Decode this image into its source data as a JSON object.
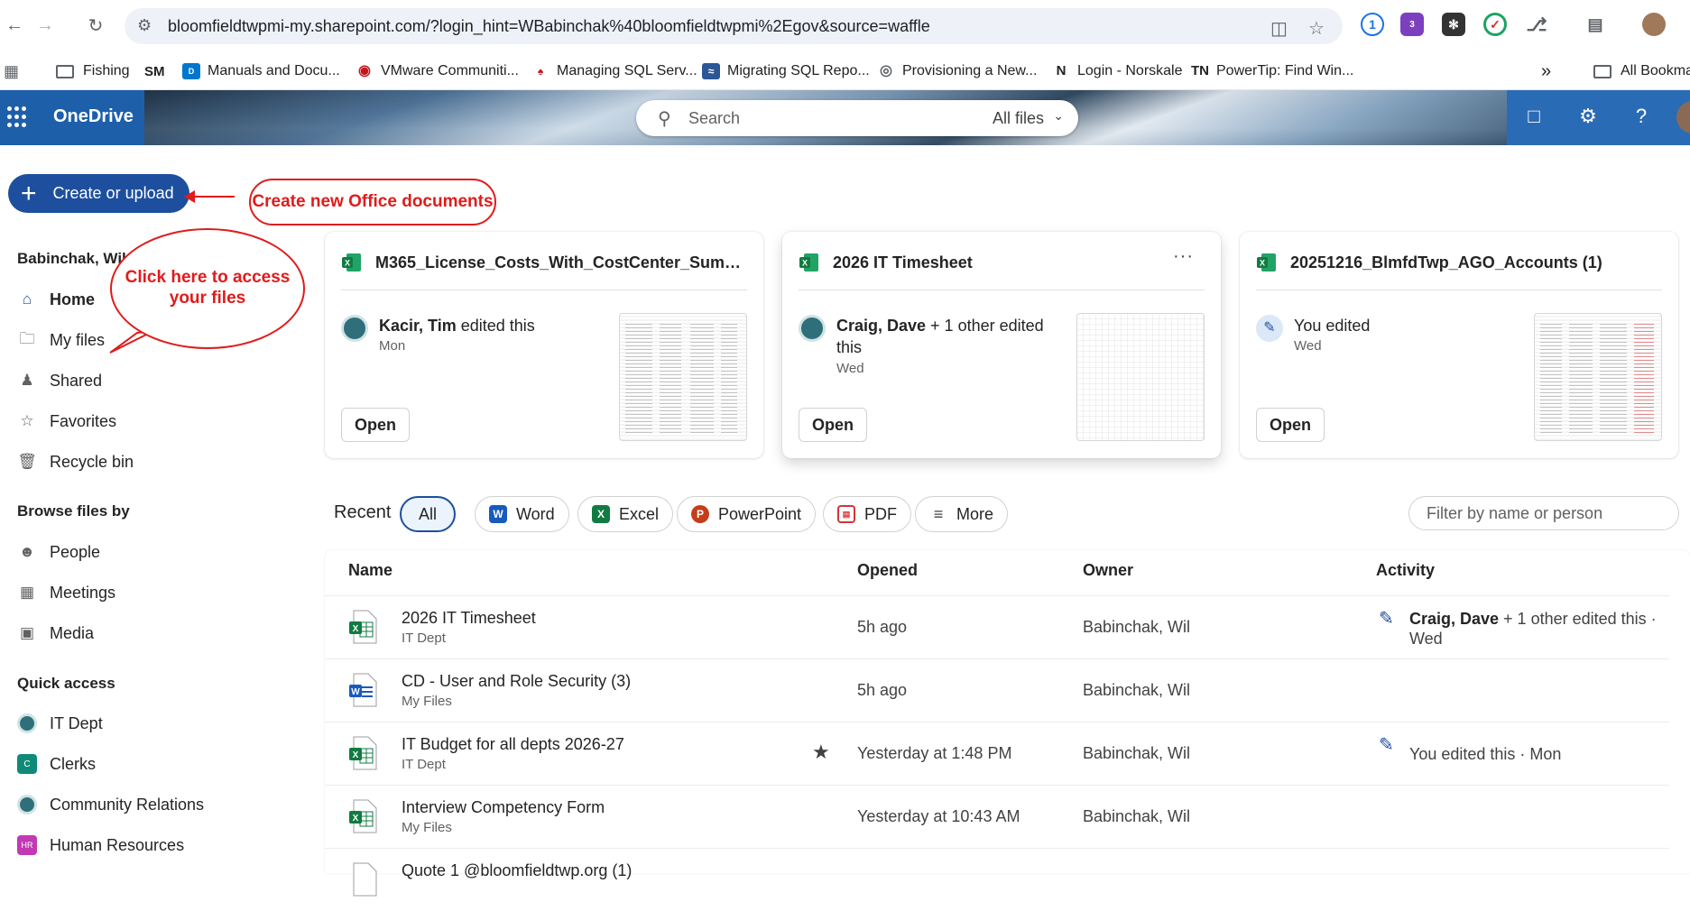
{
  "browser": {
    "url": "bloomfieldtwpmi-my.sharepoint.com/?login_hint=WBabinchak%40bloomfieldtwpmi%2Egov&source=waffle",
    "bookmarks": [
      {
        "label": "Fishing",
        "icon": "folder-icon"
      },
      {
        "label": "",
        "icon": "sm-icon",
        "badge": "SM"
      },
      {
        "label": "Manuals and Docu...",
        "icon": "dell-icon"
      },
      {
        "label": "VMware Communiti...",
        "icon": "vmware-icon"
      },
      {
        "label": "Managing SQL Serv...",
        "icon": "bookmark-site-icon"
      },
      {
        "label": "Migrating SQL Repo...",
        "icon": "bookmark-site-icon"
      },
      {
        "label": "Provisioning a New...",
        "icon": "globe-icon"
      },
      {
        "label": "Login - Norskale",
        "icon": "norskale-icon",
        "badge": "N"
      },
      {
        "label": "PowerTip: Find Win...",
        "icon": "tn-icon",
        "badge": "TN"
      }
    ],
    "overflow_label": "»",
    "all_bookmarks_label": "All Bookma",
    "ext_badge": "3"
  },
  "header": {
    "app_name": "OneDrive",
    "search_placeholder": "Search",
    "search_scope": "All files"
  },
  "actions": {
    "create_label": "Create or upload"
  },
  "annotations": {
    "create_callout": "Create new Office documents",
    "files_callout": "Click here to access your files"
  },
  "nav": {
    "user": "Babinchak, Wil",
    "items": [
      {
        "label": "Home",
        "icon": "home-icon"
      },
      {
        "label": "My files",
        "icon": "folder-icon"
      },
      {
        "label": "Shared",
        "icon": "people-icon"
      },
      {
        "label": "Favorites",
        "icon": "star-icon"
      },
      {
        "label": "Recycle bin",
        "icon": "trash-icon"
      }
    ],
    "browse_heading": "Browse files by",
    "browse": [
      {
        "label": "People",
        "icon": "person-icon"
      },
      {
        "label": "Meetings",
        "icon": "calendar-icon"
      },
      {
        "label": "Media",
        "icon": "image-icon"
      }
    ],
    "quick_heading": "Quick access",
    "quick": [
      {
        "label": "IT Dept",
        "badge": "",
        "color": "#2f6f7a"
      },
      {
        "label": "Clerks",
        "badge": "C",
        "color": "#0f8a78"
      },
      {
        "label": "Community Relations",
        "badge": "",
        "color": "#2f6f7a"
      },
      {
        "label": "Human Resources",
        "badge": "HR",
        "color": "#c239b3"
      }
    ]
  },
  "cards": [
    {
      "title": "M365_License_Costs_With_CostCenter_Summary...",
      "who": "Kacir, Tim",
      "action": " edited this",
      "when": "Mon",
      "open": "Open"
    },
    {
      "title": "2026 IT Timesheet",
      "who": "Craig, Dave",
      "action": " + 1 other edited this",
      "when": "Wed",
      "open": "Open",
      "more": "···"
    },
    {
      "title": "20251216_BlmfdTwp_AGO_Accounts (1)",
      "who": "",
      "action": "You edited",
      "when": "Wed",
      "open": "Open"
    }
  ],
  "recent": {
    "label": "Recent",
    "filters": [
      "All",
      "Word",
      "Excel",
      "PowerPoint",
      "PDF",
      "More"
    ],
    "filter_placeholder": "Filter by name or person"
  },
  "table": {
    "headers": [
      "Name",
      "Opened",
      "Owner",
      "Activity"
    ],
    "rows": [
      {
        "name": "2026 IT Timesheet",
        "location": "IT Dept",
        "opened": "5h ago",
        "owner": "Babinchak, Wil",
        "activity_bold": "Craig, Dave",
        "activity": " + 1 other edited this · Wed",
        "type": "excel"
      },
      {
        "name": "CD - User and Role Security (3)",
        "location": "My Files",
        "opened": "5h ago",
        "owner": "Babinchak, Wil",
        "activity_bold": "",
        "activity": "",
        "type": "word"
      },
      {
        "name": "IT Budget for all depts 2026-27",
        "location": "IT Dept",
        "opened": "Yesterday at 1:48 PM",
        "owner": "Babinchak, Wil",
        "activity_bold": "",
        "activity": "You edited this · Mon",
        "type": "excel",
        "starred": true
      },
      {
        "name": "Interview Competency Form",
        "location": "My Files",
        "opened": "Yesterday at 10:43 AM",
        "owner": "Babinchak, Wil",
        "activity_bold": "",
        "activity": "",
        "type": "excel"
      },
      {
        "name": "Quote 1 @bloomfieldtwp.org (1)",
        "location": "",
        "opened": "",
        "owner": "",
        "activity_bold": "",
        "activity": "",
        "type": "doc"
      }
    ]
  },
  "colors": {
    "accent": "#1d4f9e",
    "callout": "#e01b1b",
    "excel": "#107c41",
    "word": "#185abd",
    "powerpoint": "#c43e1c",
    "pdf": "#d13438"
  }
}
